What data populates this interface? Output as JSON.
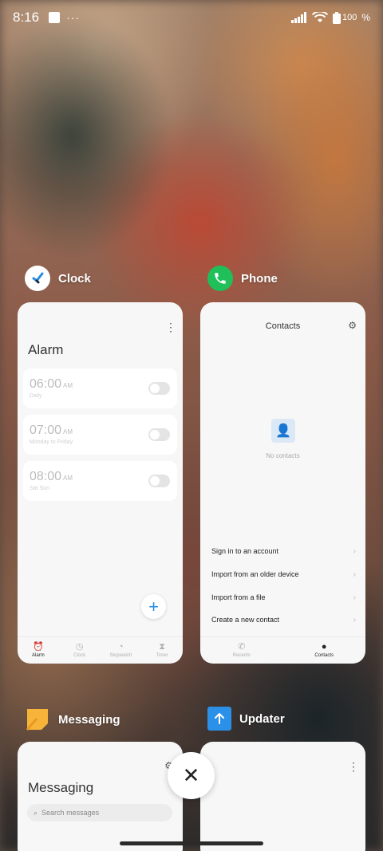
{
  "status_bar": {
    "time": "8:16",
    "more_dots": "···",
    "battery": "100",
    "battery_unit": "%"
  },
  "recents": {
    "clock": {
      "app_name": "Clock",
      "screen_title": "Alarm",
      "alarms": [
        {
          "time": "06:00",
          "ampm": "AM",
          "repeat": "Daily"
        },
        {
          "time": "07:00",
          "ampm": "AM",
          "repeat": "Monday to Friday"
        },
        {
          "time": "08:00",
          "ampm": "AM",
          "repeat": "Sat Sun"
        }
      ],
      "add_symbol": "+",
      "tabs": [
        {
          "label": "Alarm",
          "icon": "alarm-clock-icon",
          "active": true
        },
        {
          "label": "Clock",
          "icon": "clock-icon",
          "active": false
        },
        {
          "label": "Stopwatch",
          "icon": "stopwatch-icon",
          "active": false
        },
        {
          "label": "Timer",
          "icon": "hourglass-icon",
          "active": false
        }
      ]
    },
    "phone": {
      "app_name": "Phone",
      "screen_title": "Contacts",
      "empty_text": "No contacts",
      "actions": [
        "Sign in to an account",
        "Import from an older device",
        "Import from a file",
        "Create a new contact"
      ],
      "tabs": [
        {
          "label": "Recents",
          "icon": "phone-icon",
          "active": false
        },
        {
          "label": "Contacts",
          "icon": "person-icon",
          "active": true
        }
      ]
    },
    "messaging": {
      "app_name": "Messaging",
      "screen_title": "Messaging",
      "search_placeholder": "Search messages"
    },
    "updater": {
      "app_name": "Updater"
    }
  },
  "close_all_symbol": "✕",
  "colors": {
    "phone_icon": "#1fbf5a",
    "clock_accent": "#2b8ce0",
    "messaging_icon": "#f6b53a",
    "updater_icon": "#2b90e8"
  }
}
